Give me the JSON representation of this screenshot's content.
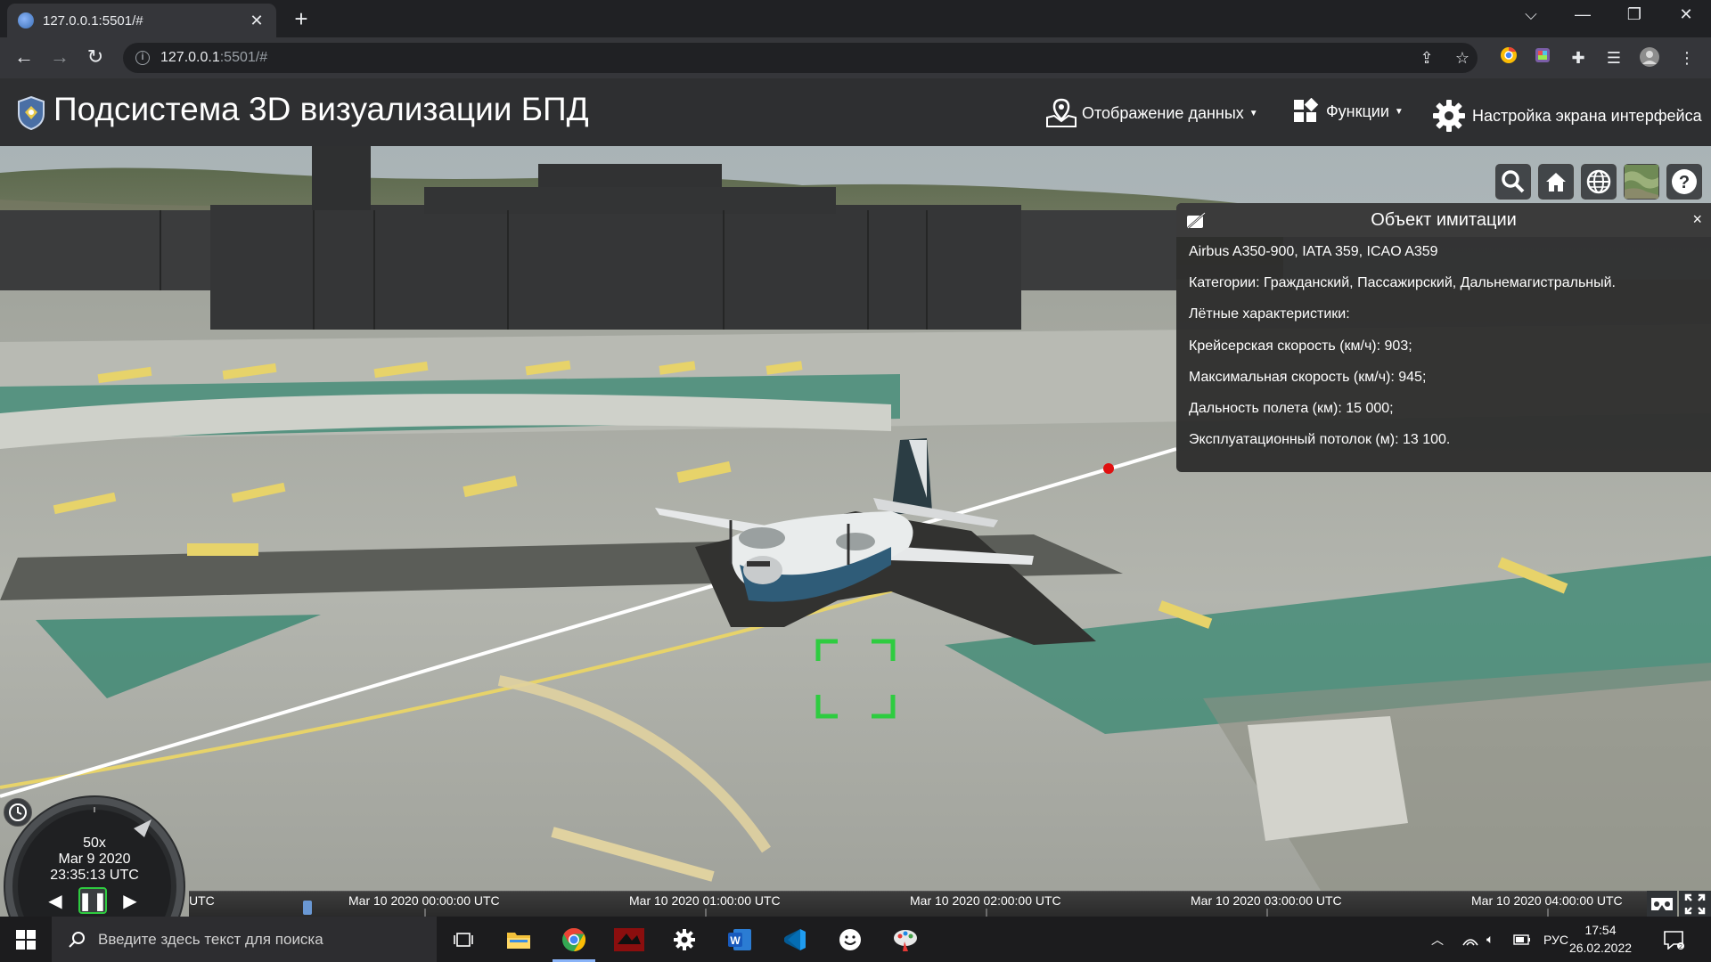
{
  "browser": {
    "tab_title": "127.0.0.1:5501/#",
    "url_host": "127.0.0.1",
    "url_rest": ":5501/#"
  },
  "header": {
    "title": "Подсистема 3D визуализации БПД",
    "menu_data": "Отображение данных",
    "menu_functions": "Функции",
    "menu_settings": "Настройка экрана интерфейса"
  },
  "info_panel": {
    "title": "Объект имитации",
    "close": "×",
    "lines": [
      "Airbus A350-900, IATA 359, ICAO A359",
      "Категории: Гражданский, Пассажирский, Дальнемагистральный.",
      "Лётные характеристики:",
      "Крейсерская скорость (км/ч): 903;",
      "Максимальная скорость (км/ч): 945;",
      "Дальность полета (км): 15 000;",
      "Эксплуатационный потолок (м): 13 100."
    ]
  },
  "animation": {
    "speed": "50x",
    "date": "Mar 9 2020",
    "time": "23:35:13 UTC"
  },
  "timeline": {
    "labels": [
      "UTC",
      "Mar 10 2020 00:00:00 UTC",
      "Mar 10 2020 01:00:00 UTC",
      "Mar 10 2020 02:00:00 UTC",
      "Mar 10 2020 03:00:00 UTC",
      "Mar 10 2020 04:00:00 UTC"
    ]
  },
  "taskbar": {
    "search_placeholder": "Введите здесь текст для поиска",
    "language": "РУС",
    "time": "17:54",
    "date": "26.02.2022"
  },
  "colors": {
    "selection": "#2ecc40",
    "track": "#ffffff",
    "track_point": "#e01010",
    "header_bg": "#2e2f31",
    "markings_green": "#3f8a74",
    "markings_yellow": "#e7d36a"
  },
  "icons": {
    "search_tool": "search-icon",
    "home_tool": "home-icon",
    "scene_mode": "globe-icon",
    "base_layer": "layers-icon",
    "help": "help-icon"
  }
}
